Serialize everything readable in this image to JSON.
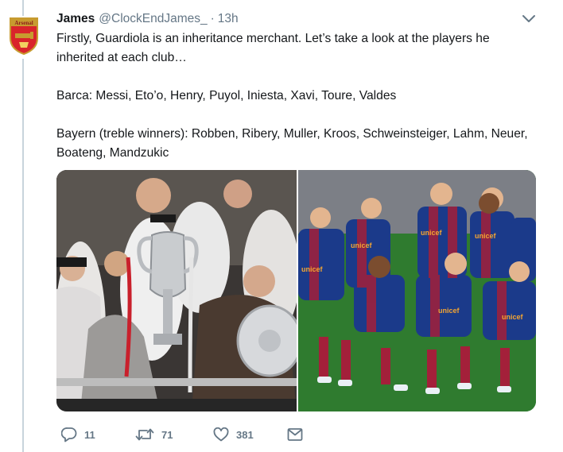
{
  "tweet": {
    "display_name": "James",
    "handle": "@ClockEndJames_",
    "separator": "·",
    "timestamp": "13h",
    "avatar_icon": "arsenal-crest-icon",
    "avatar_text": "Arsenal",
    "text_lines": [
      "Firstly, Guardiola is an inheritance merchant. Let’s take a look at the players he inherited at each club…",
      "Barca: Messi, Eto’o, Henry, Puyol, Iniesta, Xavi, Toure, Valdes",
      "Bayern (treble winners): Robben, Ribery, Muller, Kroos, Schweinsteiger, Lahm, Neuer, Boateng, Mandzukic"
    ],
    "media": [
      {
        "name": "bayern-trophy-photo"
      },
      {
        "name": "barcelona-team-photo",
        "shirt_text": "unicef"
      }
    ],
    "actions": {
      "reply_count": "11",
      "retweet_count": "71",
      "like_count": "381"
    }
  },
  "colors": {
    "text_primary": "#14171a",
    "text_secondary": "#657786",
    "thread_line": "#c8d4dc",
    "arsenal_red": "#d9242b",
    "arsenal_gold": "#c79b2f",
    "barca_blue": "#1b3a8a",
    "barca_red": "#a3203a"
  }
}
